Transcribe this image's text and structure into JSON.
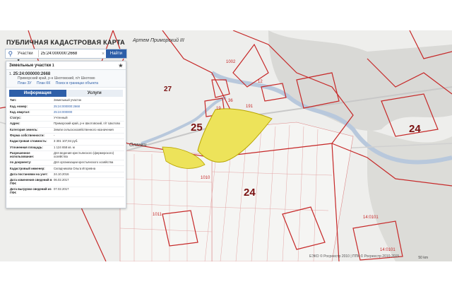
{
  "map": {
    "title": "ПУБЛИЧНАЯ КАДАСТРОВАЯ КАРТА",
    "labels": [
      {
        "text": "25",
        "cls": "big"
      },
      {
        "text": "24",
        "cls": "big"
      },
      {
        "text": "24",
        "cls": "big"
      },
      {
        "text": "27",
        "cls": "big"
      }
    ],
    "parcel_numbers": [
      "1002",
      "1010",
      "1011",
      "12",
      "14:0101",
      "14:0101",
      "19",
      "36",
      "191"
    ],
    "places": [
      "Артем Приморский III",
      "Оленки"
    ],
    "copyright": "ЕЭКО © Росреестр 2010 | ППК © Росреестр 2010-2015",
    "scale": "50 km"
  },
  "search": {
    "type": "Участки",
    "value": "25:24:000000:2668",
    "find_label": "Найти"
  },
  "panel": {
    "header": "Земельные участки",
    "header_count": "1",
    "result": {
      "index": "1.",
      "number": "25:24:000000:2668",
      "address": "Приморский край, р-н Шкотовский, п/т Шкотово",
      "links": [
        "План ЗУ",
        "План КК",
        "Поиск в границах объекта"
      ]
    },
    "tabs": {
      "info": "Информация",
      "services": "Услуги"
    },
    "rows": [
      {
        "k": "Тип:",
        "v": "Земельный участок"
      },
      {
        "k": "Кад. номер:",
        "v": "25:24:000000:2668",
        "link": true
      },
      {
        "k": "Кад. квартал:",
        "v": "25:24:000000",
        "link": true
      },
      {
        "k": "Статус:",
        "v": "Учтенный"
      },
      {
        "k": "Адрес:",
        "v": "Приморский край, р-н Шкотовский, п/т Шкотово"
      },
      {
        "k": "Категория земель:",
        "v": "Земли сельскохозяйственного назначения"
      },
      {
        "k": "Форма собственности:",
        "v": "-"
      },
      {
        "k": "Кадастровая стоимость:",
        "v": "3 301 107,84 руб."
      },
      {
        "k": "Уточненная площадь:",
        "v": "1 124 658 кв. м"
      },
      {
        "k": "Разрешенное использование:",
        "v": "Для ведения крестьянского (фермерского) хозяйства"
      },
      {
        "k": "по документу:",
        "v": "Для организации крестьянского хозяйства"
      },
      {
        "k": "Кадастровый инженер:",
        "v": "Складчикова Ольга Игоревна"
      },
      {
        "k": "Дата постановки на учет:",
        "v": "24.10.2016"
      },
      {
        "k": "Дата изменения сведений в ГКН:",
        "v": "06.02.2017"
      },
      {
        "k": "Дата выгрузки сведений из ГКН:",
        "v": "07.02.2017"
      }
    ]
  }
}
